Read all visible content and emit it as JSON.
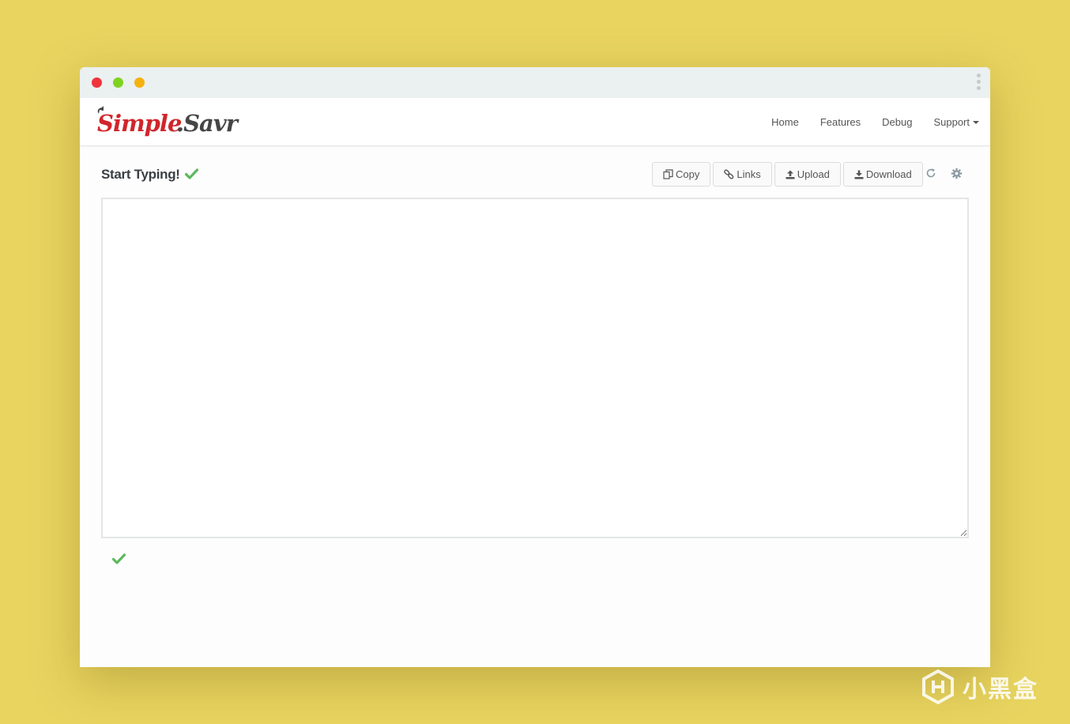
{
  "window": {
    "dots": [
      {
        "name": "close",
        "color": "#f0343c"
      },
      {
        "name": "minimize",
        "color": "#7ed321"
      },
      {
        "name": "maximize",
        "color": "#f5b20f"
      }
    ]
  },
  "navbar": {
    "logo_text": "Simple.Savr",
    "items": [
      {
        "label": "Home"
      },
      {
        "label": "Features"
      },
      {
        "label": "Debug"
      },
      {
        "label": "Support",
        "dropdown": true
      }
    ]
  },
  "toolbar": {
    "title": "Start Typing!",
    "status_icon": "check-icon",
    "buttons": [
      {
        "label": "Copy",
        "icon": "copy-icon"
      },
      {
        "label": "Links",
        "icon": "link-icon"
      },
      {
        "label": "Upload",
        "icon": "upload-icon"
      },
      {
        "label": "Download",
        "icon": "download-icon"
      }
    ],
    "icon_buttons": [
      "refresh-icon",
      "gear-icon"
    ]
  },
  "editor": {
    "value": "",
    "placeholder": ""
  },
  "status": {
    "icon": "check-icon"
  },
  "colors": {
    "background": "#e8d45f",
    "accent_red": "#d0262b",
    "check_green": "#5cb85c"
  },
  "watermark": {
    "text": "小黑盒"
  }
}
